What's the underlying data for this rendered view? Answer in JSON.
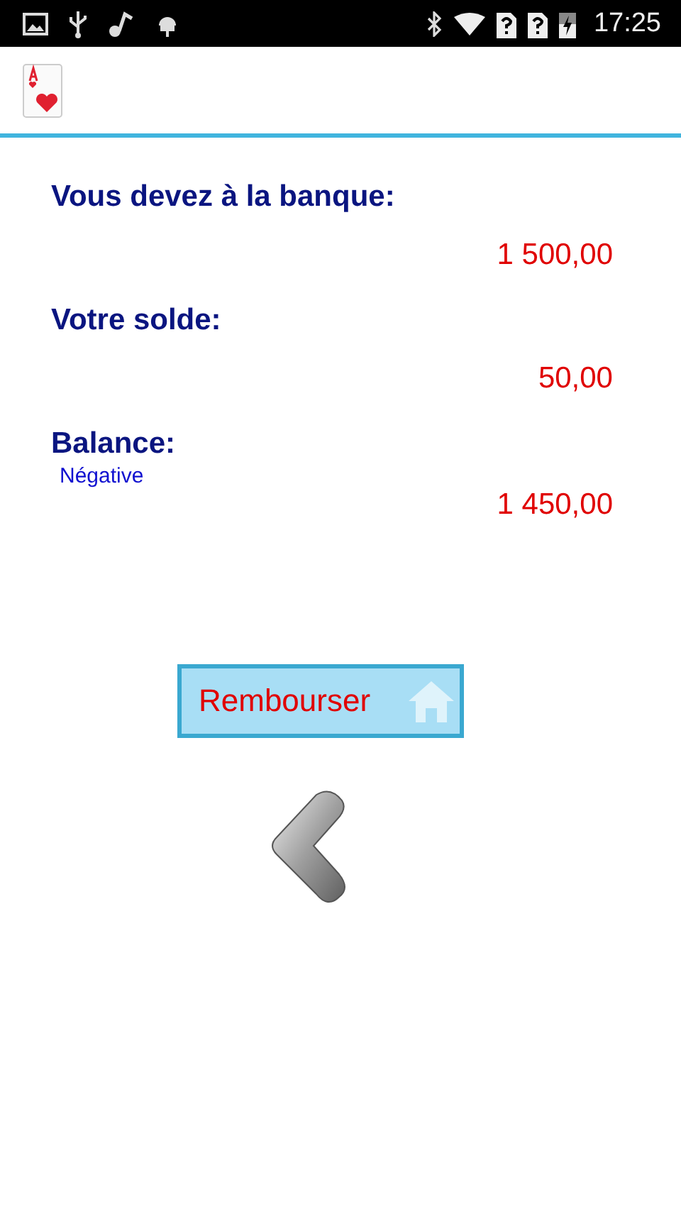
{
  "status_bar": {
    "time": "17:25"
  },
  "rows": [
    {
      "label": "Vous devez à la banque:",
      "value": "1 500,00"
    },
    {
      "label": "Votre solde:",
      "value": "50,00"
    },
    {
      "label": "Balance:",
      "note": "Négative",
      "value": "1 450,00"
    }
  ],
  "repay_button": {
    "label": "Rembourser"
  }
}
